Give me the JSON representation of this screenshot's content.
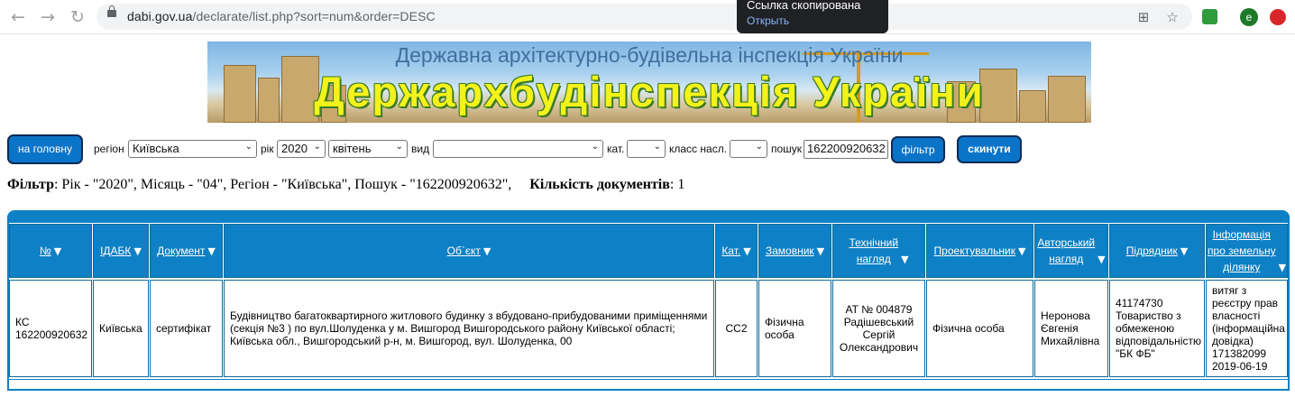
{
  "browser": {
    "url_host": "dabi.gov.ua",
    "url_path": "/declarate/list.php?sort=num&order=DESC",
    "toast_title": "Ссылка скопирована",
    "toast_action": "Открыть",
    "ext_e_label": "e"
  },
  "banner": {
    "subtitle": "Державна архітектурно-будівельна інспекція України",
    "title": "Держархбудінспекція України"
  },
  "filters": {
    "home_button": "на головну",
    "region_label": "регіон",
    "region_value": "Київська",
    "year_label": "рік",
    "year_value": "2020",
    "month_value": "квітень",
    "type_label": "вид",
    "type_value": "",
    "cat_label": "кат.",
    "cat_value": "",
    "class_label": "класс насл.",
    "class_value": "",
    "search_label": "пошук",
    "search_value": "162200920632",
    "filter_button": "фільтр",
    "reset_button": "скинути"
  },
  "summary": {
    "filter_label": "Фільтр",
    "filter_text": ": Рік - \"2020\", Місяць - \"04\", Регіон - \"Київська\", Пошук - \"162200920632\",     ",
    "count_label": "Кількість документів",
    "count_value": ": 1"
  },
  "table": {
    "headers": [
      {
        "l1": "№",
        "l2": ""
      },
      {
        "l1": "ІДАБК",
        "l2": ""
      },
      {
        "l1": "Документ",
        "l2": ""
      },
      {
        "l1": "Об`єкт",
        "l2": ""
      },
      {
        "l1": "Кат.",
        "l2": ""
      },
      {
        "l1": "Замовник",
        "l2": ""
      },
      {
        "l1": "Технічний",
        "l2": "нагляд"
      },
      {
        "l1": "Проектувальник",
        "l2": ""
      },
      {
        "l1": "Авторський",
        "l2": "нагляд"
      },
      {
        "l1": "Підрядник",
        "l2": ""
      },
      {
        "l1": "Інформація",
        "l2": "про земельну",
        "l3": "ділянку"
      }
    ],
    "row": {
      "num": "КС 162200920632",
      "idabk": "Київська",
      "doc": "сертифікат",
      "object": "Будівництво багатоквартирного житлового будинку з вбудовано-прибудованими приміщеннями (секція №3 ) по вул.Шолуденка у м. Вишгород Вишгородського району Київської області; Київська обл., Вишгородський р-н, м. Вишгород, вул. Шолуденка, 00",
      "cat": "СС2",
      "customer": "Фізична особа",
      "tech": "АТ № 004879 Радішевський Сергій Олександрович",
      "designer": "Фізична особа",
      "author": "Неронова Євгенія Михайлівна",
      "contractor": "41174730 Товариство з обмеженою відповідальністю \"БК ФБ\"",
      "land": "витяг з реєстру прав власності (інформаційна довідка) 171382099 2019-06-19"
    }
  },
  "colors": {
    "header_blue": "#0e80c5",
    "button_blue": "#0a74c8",
    "banner_yellow": "#f3f21a"
  }
}
